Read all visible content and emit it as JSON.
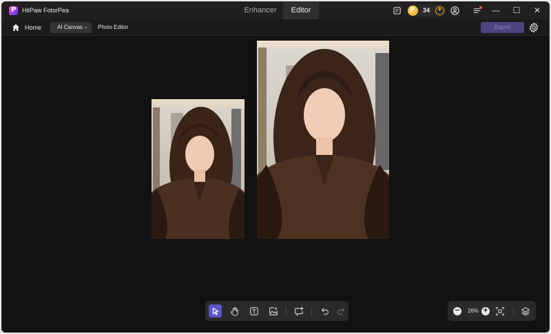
{
  "app": {
    "title": "HitPaw FotorPea"
  },
  "tabs": [
    {
      "label": "Enhancer",
      "active": false
    },
    {
      "label": "Editor",
      "active": true
    }
  ],
  "credits": {
    "count": "34"
  },
  "window_controls": {
    "minimize": "—",
    "maximize": "☐",
    "close": "✕"
  },
  "nav": {
    "home_label": "Home",
    "mode_select": "AI Canvas",
    "section_label": "Photo Editor",
    "export_label": "Export"
  },
  "toolbar": {
    "tools": [
      "select-tool",
      "hand-tool",
      "text-tool",
      "add-image-tool",
      "ai-comment-tool",
      "undo",
      "redo"
    ],
    "active_tool": "select-tool"
  },
  "zoom": {
    "level": "26%",
    "minus": "−",
    "plus": "+"
  },
  "colors": {
    "accent": "#5b55c9",
    "export_bg": "#4b4480",
    "credit_gold": "#f2a81b",
    "notify": "#ff4d4f"
  }
}
